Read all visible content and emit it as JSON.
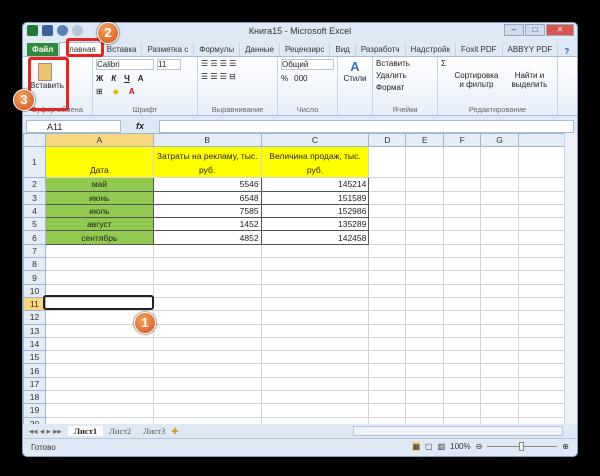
{
  "window": {
    "title": "Книга15 - Microsoft Excel"
  },
  "tabs": [
    "Файл",
    "Главная",
    "Вставка",
    "Разметка с",
    "Формулы",
    "Данные",
    "Рецензирс",
    "Вид",
    "Разработч",
    "Надстройк",
    "Foxit PDF",
    "ABBYY PDF"
  ],
  "ribbon": {
    "clipboard": {
      "label": "Буфер обмена",
      "paste": "Вставить"
    },
    "font": {
      "label": "Шрифт",
      "name": "Calibri",
      "size": "11",
      "bold": "Ж",
      "italic": "К",
      "underline": "Ч"
    },
    "alignment": {
      "label": "Выравнивание"
    },
    "number": {
      "label": "Число",
      "format": "Общий",
      "percent": "%",
      "thousands": "000"
    },
    "styles": {
      "label": "Стили"
    },
    "cells": {
      "label": "Ячейки",
      "insert": "Вставить",
      "delete": "Удалить",
      "format": "Формат"
    },
    "editing": {
      "label": "Редактирование",
      "sort": "Сортировка и фильтр",
      "find": "Найти и выделить"
    }
  },
  "formula_bar": {
    "name_box": "A11",
    "fx": "fx",
    "value": ""
  },
  "columns": [
    "A",
    "B",
    "C",
    "D",
    "E",
    "F",
    "G"
  ],
  "headers": {
    "date": "Дата",
    "ad": "Затраты на рекламу, тыс. руб.",
    "sales": "Величина продаж, тыс. руб."
  },
  "rows": [
    {
      "month": "май",
      "ad": "5546",
      "sales": "145214"
    },
    {
      "month": "июнь",
      "ad": "6548",
      "sales": "151589"
    },
    {
      "month": "июль",
      "ad": "7585",
      "sales": "152986"
    },
    {
      "month": "август",
      "ad": "1452",
      "sales": "135289"
    },
    {
      "month": "сентябрь",
      "ad": "4852",
      "sales": "142458"
    }
  ],
  "sheets": [
    "Лист1",
    "Лист2",
    "Лист3"
  ],
  "status": {
    "ready": "Готово",
    "zoom": "100%"
  },
  "callouts": [
    "1",
    "2",
    "3"
  ],
  "colors": {
    "header_fill": "#ffff00",
    "month_fill": "#92c94f",
    "highlight": "#e8241c",
    "file_tab": "#2e8b3a"
  }
}
